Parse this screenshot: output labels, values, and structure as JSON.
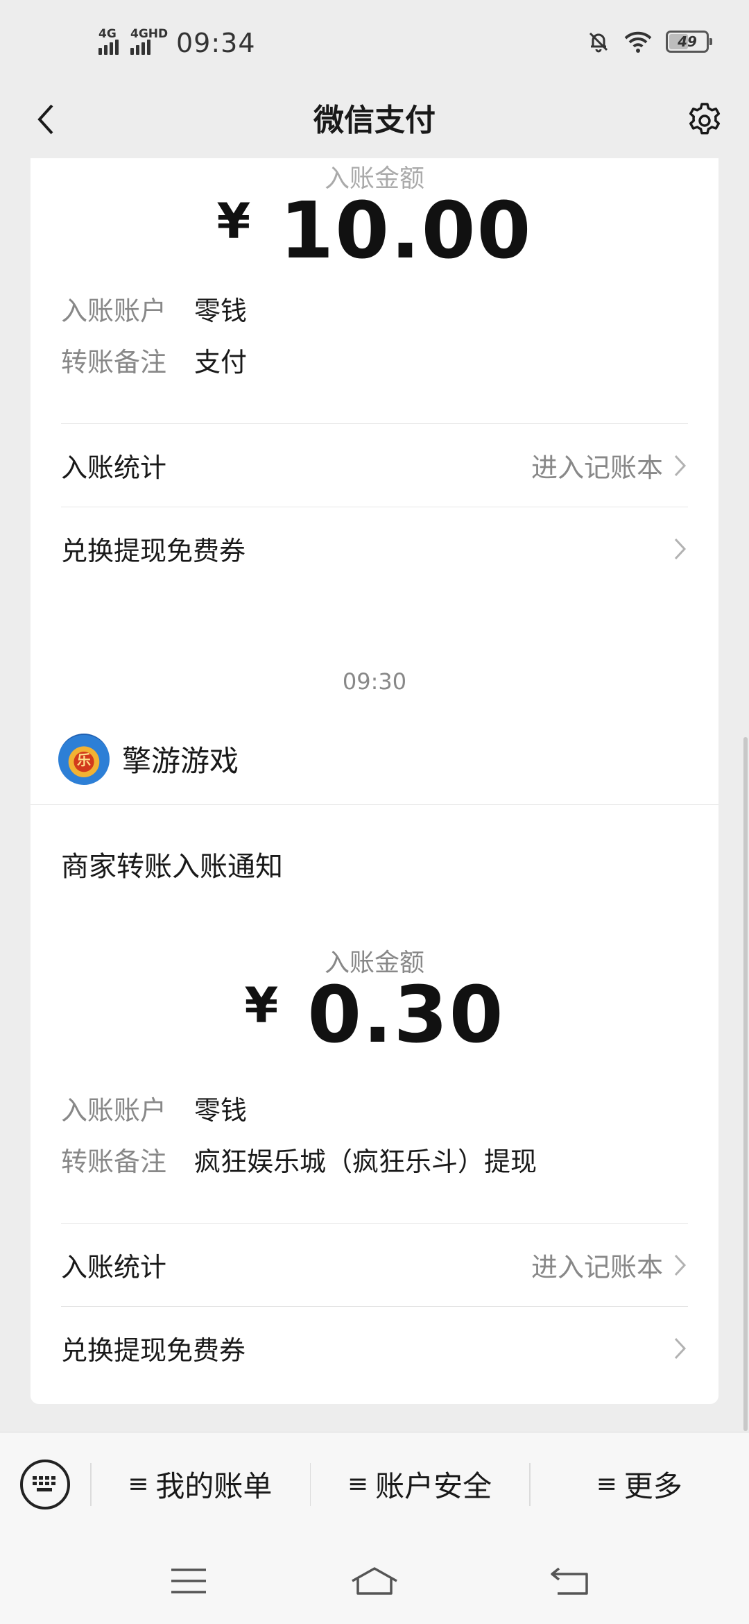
{
  "status_bar": {
    "network1": "4G",
    "network2": "4GHD",
    "time": "09:34",
    "battery": "49",
    "battery_level": 0.49
  },
  "nav": {
    "title": "微信支付",
    "back_icon": "chevron-left-icon",
    "settings_icon": "gear-icon"
  },
  "card1": {
    "amount_label": "入账金额",
    "currency": "¥",
    "amount": "10.00",
    "account_key": "入账账户",
    "account_value": "零钱",
    "note_key": "转账备注",
    "note_value": "支付",
    "stats_label": "入账统计",
    "stats_link": "进入记账本",
    "coupon_label": "兑换提现免费券"
  },
  "time_separator": "09:30",
  "card2": {
    "merchant_name": "擎游游戏",
    "merchant_logo_text": "乐",
    "notice_title": "商家转账入账通知",
    "amount_label": "入账金额",
    "currency": "¥",
    "amount": "0.30",
    "account_key": "入账账户",
    "account_value": "零钱",
    "note_key": "转账备注",
    "note_value": "疯狂娱乐城（疯狂乐斗）提现",
    "stats_label": "入账统计",
    "stats_link": "进入记账本",
    "coupon_label": "兑换提现免费券"
  },
  "bottom_menu": {
    "keyboard_icon": "keyboard-icon",
    "items": [
      {
        "icon": "≡",
        "label": "我的账单"
      },
      {
        "icon": "≡",
        "label": "账户安全"
      },
      {
        "icon": "≡",
        "label": "更多"
      }
    ]
  },
  "system_nav": {
    "menu_icon": "menu-icon",
    "home_icon": "home-icon",
    "back_icon": "back-icon"
  }
}
